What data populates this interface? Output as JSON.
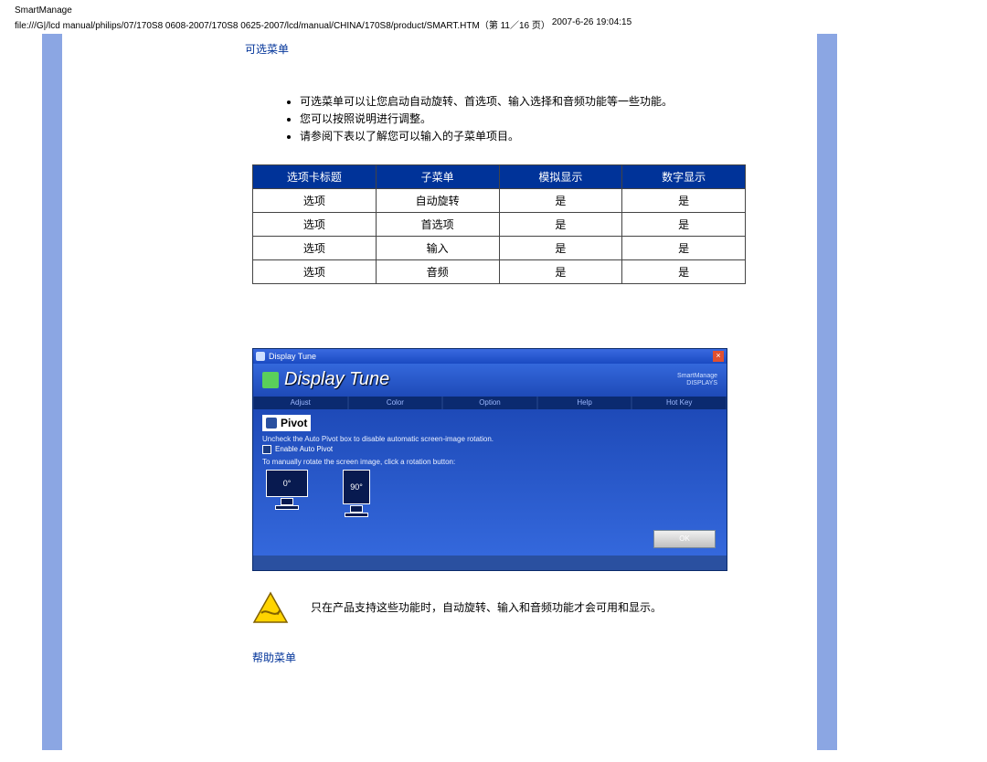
{
  "page_header": "SmartManage",
  "section_title_options": "可选菜单",
  "bullets": [
    "可选菜单可以让您启动自动旋转、首选项、输入选择和音频功能等一些功能。",
    "您可以按照说明进行调整。",
    "请参阅下表以了解您可以输入的子菜单项目。"
  ],
  "table": {
    "headers": [
      "选项卡标题",
      "子菜单",
      "模拟显示",
      "数字显示"
    ],
    "rows": [
      [
        "选项",
        "自动旋转",
        "是",
        "是"
      ],
      [
        "选项",
        "首选项",
        "是",
        "是"
      ],
      [
        "选项",
        "输入",
        "是",
        "是"
      ],
      [
        "选项",
        "音频",
        "是",
        "是"
      ]
    ]
  },
  "screenshot": {
    "title": "Display Tune",
    "brand": "Display Tune",
    "model_lines": [
      "SmartManage",
      "DISPLAYS"
    ],
    "tabs": [
      "Adjust",
      "Color",
      "Option",
      "Help",
      "Hot Key"
    ],
    "pivot_label": "Pivot",
    "uncheck_line": "Uncheck the Auto Pivot box to disable automatic screen-image rotation.",
    "checkbox_label": "Enable Auto Pivot",
    "manual_line": "To manually rotate the screen image, click a rotation button:",
    "rot0": "0°",
    "rot90": "90°",
    "ok": "OK",
    "close_glyph": "×"
  },
  "note_text": "只在产品支持这些功能时，自动旋转、输入和音频功能才会可用和显示。",
  "section_title_help": "帮助菜单",
  "footer_part1": "file:///G|/lcd manual/philips/07/170S8 0608-2007/170S8 0625-2007/lcd/manual/CHINA/170S8/product/SMART.HTM（第 11／16 页）",
  "footer_part2": "2007-6-26 19:04:15"
}
